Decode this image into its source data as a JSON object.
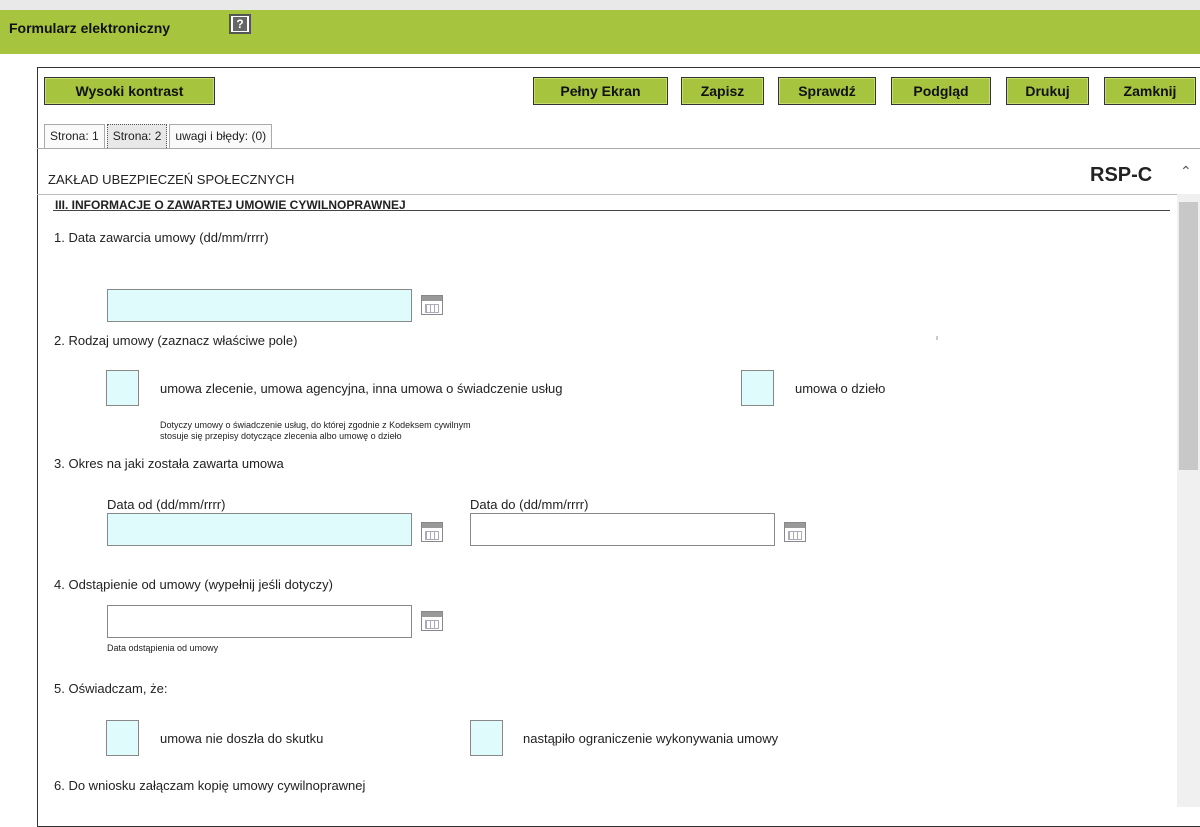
{
  "app": {
    "title": "Formularz elektroniczny",
    "help_glyph": "?"
  },
  "toolbar": {
    "contrast_label": "Wysoki kontrast",
    "fullscreen_label": "Pełny Ekran",
    "save_label": "Zapisz",
    "check_label": "Sprawdź",
    "preview_label": "Podgląd",
    "print_label": "Drukuj",
    "close_label": "Zamknij"
  },
  "tabs": [
    {
      "label": "Strona: 1",
      "active": false
    },
    {
      "label": "Strona: 2",
      "active": true
    },
    {
      "label": "uwagi i błędy: (0)",
      "active": false
    }
  ],
  "form": {
    "institution": "ZAKŁAD UBEZPIECZEŃ SPOŁECZNYCH",
    "code": "RSP-C",
    "section_title": "III. INFORMACJE O ZAWARTEJ UMOWIE CYWILNOPRAWNEJ",
    "q1": {
      "label": "1. Data zawarcia umowy (dd/mm/rrrr)",
      "value": ""
    },
    "q2": {
      "label": "2. Rodzaj umowy (zaznacz właściwe pole)",
      "option1": "umowa zlecenie, umowa agencyjna, inna umowa o świadczenie usług",
      "option2": "umowa o dzieło",
      "note_line1": "Dotyczy umowy o świadczenie usług, do której zgodnie z Kodeksem cywilnym",
      "note_line2": "stosuje się przepisy dotyczące zlecenia albo umowę o dzieło"
    },
    "q3": {
      "label": "3. Okres na jaki została zawarta umowa",
      "from_label": "Data od (dd/mm/rrrr)",
      "to_label": "Data do (dd/mm/rrrr)"
    },
    "q4": {
      "label": "4. Odstąpienie od umowy (wypełnij jeśli dotyczy)",
      "caption": "Data odstąpienia od umowy"
    },
    "q5": {
      "label": "5. Oświadczam, że:",
      "option1": "umowa nie doszła do skutku",
      "option2": "nastąpiło ograniczenie wykonywania umowy"
    },
    "q6": {
      "label": "6. Do wniosku załączam kopię umowy cywilnoprawnej"
    }
  },
  "colors": {
    "header": "#a6c43e",
    "input": "#e0fbfb"
  },
  "icons": {
    "help": "help-icon",
    "calendar": "calendar-icon",
    "scroll_up": "chevron-up-icon"
  }
}
